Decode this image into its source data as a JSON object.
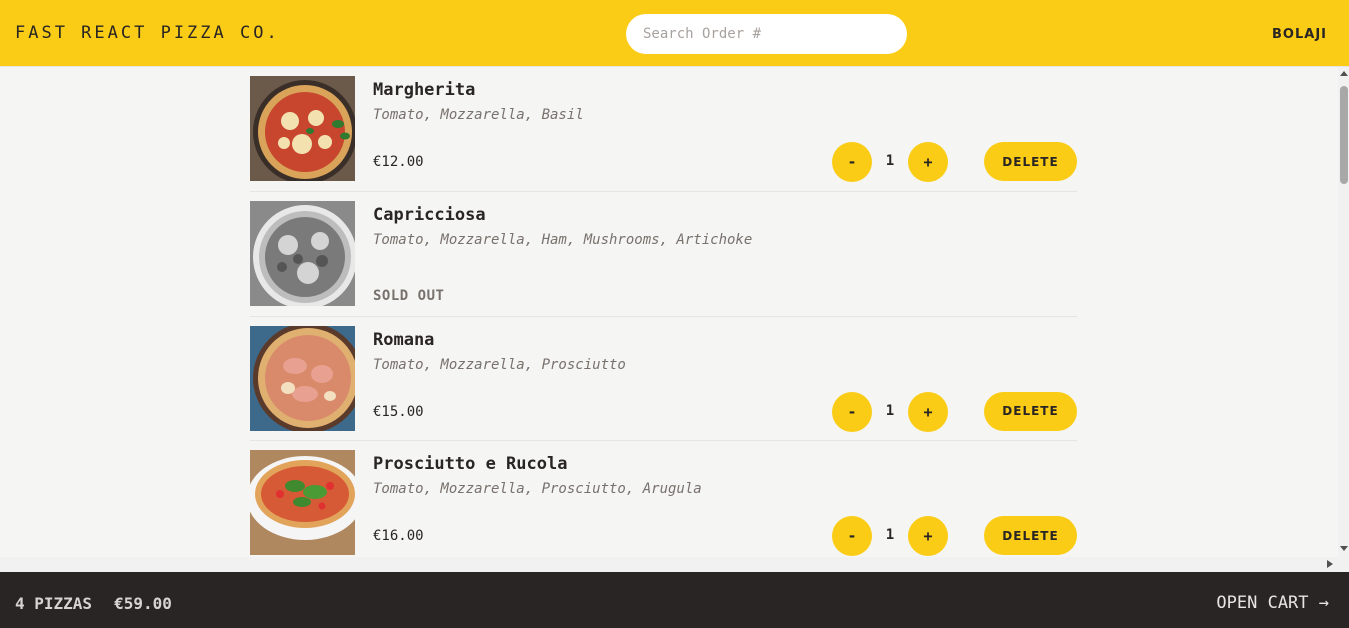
{
  "header": {
    "logo": "Fast React Pizza Co.",
    "search_placeholder": "Search Order #",
    "username": "BOLAJI"
  },
  "menu": [
    {
      "name": "Margherita",
      "ingredients": "Tomato, Mozzarella, Basil",
      "price": "€12.00",
      "sold_out": false,
      "quantity": "1"
    },
    {
      "name": "Capricciosa",
      "ingredients": "Tomato, Mozzarella, Ham, Mushrooms, Artichoke",
      "sold_out": true,
      "sold_out_label": "SOLD OUT"
    },
    {
      "name": "Romana",
      "ingredients": "Tomato, Mozzarella, Prosciutto",
      "price": "€15.00",
      "sold_out": false,
      "quantity": "1"
    },
    {
      "name": "Prosciutto e Rucola",
      "ingredients": "Tomato, Mozzarella, Prosciutto, Arugula",
      "price": "€16.00",
      "sold_out": false,
      "quantity": "1"
    }
  ],
  "controls": {
    "decrease_label": "-",
    "increase_label": "+",
    "delete_label": "DELETE"
  },
  "footer": {
    "pizza_count": "4 pizzas",
    "total": "€59.00",
    "open_cart": "Open cart →"
  },
  "colors": {
    "accent": "#facc15",
    "footer_bg": "#292524",
    "page_bg": "#f5f5f4"
  }
}
